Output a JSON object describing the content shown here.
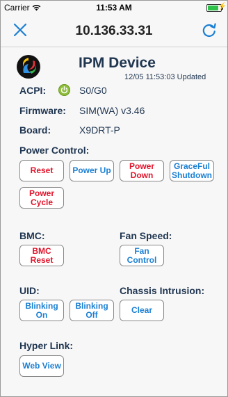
{
  "status_bar": {
    "carrier": "Carrier",
    "time": "11:53 AM"
  },
  "nav": {
    "title": "10.136.33.31",
    "close_icon": "close-icon",
    "refresh_icon": "refresh-icon",
    "accent": "#1a7fd3"
  },
  "device": {
    "title": "IPM Device",
    "updated": "12/05 11:53:03 Updated",
    "acpi_label": "ACPI:",
    "acpi_value": "S0/G0",
    "firmware_label": "Firmware:",
    "firmware_value": "SIM(WA) v3.46",
    "board_label": "Board:",
    "board_value": "X9DRT-P"
  },
  "power_control": {
    "label": "Power Control:",
    "reset": "Reset",
    "power_up": "Power Up",
    "power_down": "Power Down",
    "graceful_shutdown": "GraceFul Shutdown",
    "power_cycle": "Power Cycle"
  },
  "bmc": {
    "label": "BMC:",
    "reset": "BMC Reset"
  },
  "fan_speed": {
    "label": "Fan Speed:",
    "control": "Fan Control"
  },
  "uid": {
    "label": "UID:",
    "blinking_on": "Blinking On",
    "blinking_off": "Blinking Off"
  },
  "chassis_intrusion": {
    "label": "Chassis Intrusion:",
    "clear": "Clear"
  },
  "hyper_link": {
    "label": "Hyper Link:",
    "web_view": "Web View"
  },
  "colors": {
    "danger": "#e1132a",
    "primary": "#1a7fd3",
    "label": "#1f3550"
  }
}
